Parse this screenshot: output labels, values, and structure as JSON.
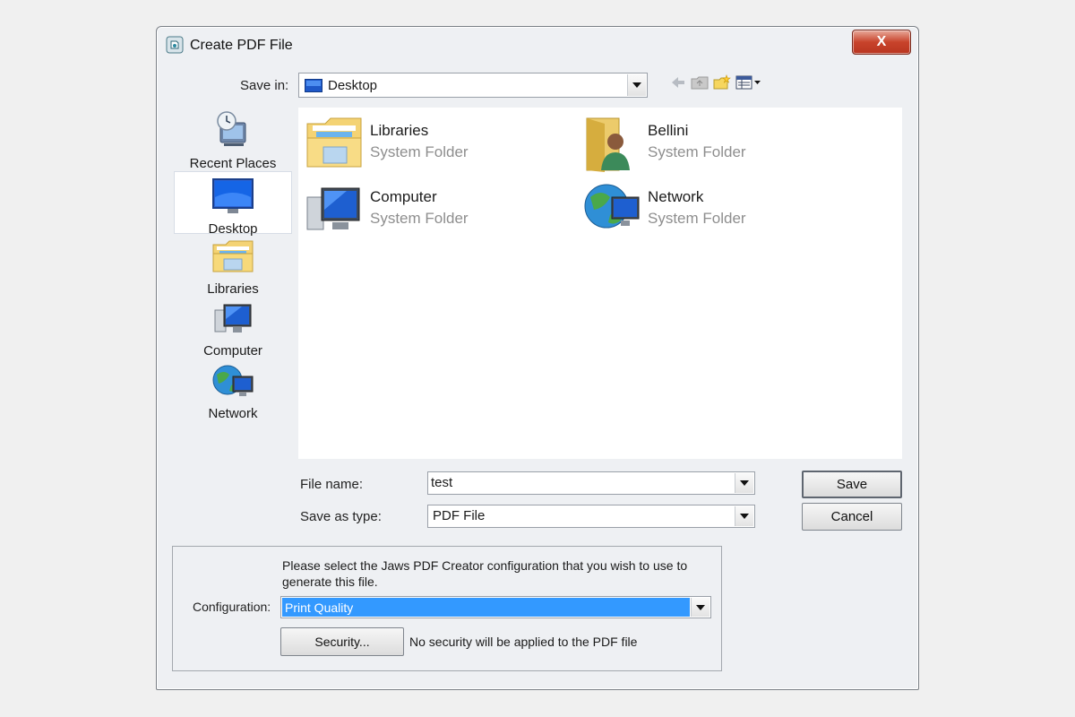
{
  "window": {
    "title": "Create PDF File",
    "close_label": "X"
  },
  "save_in": {
    "label": "Save in:",
    "value": "Desktop"
  },
  "places": [
    {
      "label": "Recent Places",
      "icon": "recent-places-icon"
    },
    {
      "label": "Desktop",
      "icon": "desktop-icon",
      "selected": true
    },
    {
      "label": "Libraries",
      "icon": "libraries-icon"
    },
    {
      "label": "Computer",
      "icon": "computer-icon"
    },
    {
      "label": "Network",
      "icon": "network-icon"
    }
  ],
  "files": [
    {
      "name": "Libraries",
      "type": "System Folder",
      "icon": "libraries-folder-icon"
    },
    {
      "name": "Bellini",
      "type": "System Folder",
      "icon": "user-folder-icon"
    },
    {
      "name": "Computer",
      "type": "System Folder",
      "icon": "computer-icon"
    },
    {
      "name": "Network",
      "type": "System Folder",
      "icon": "network-icon"
    }
  ],
  "file_name": {
    "label": "File name:",
    "value": "test"
  },
  "save_as_type": {
    "label": "Save as type:",
    "value": "PDF File"
  },
  "buttons": {
    "save": "Save",
    "cancel": "Cancel",
    "security": "Security..."
  },
  "config": {
    "description": "Please select the Jaws PDF Creator configuration that you wish to use to generate this file.",
    "label": "Configuration:",
    "value": "Print Quality",
    "security_note": "No security will be applied to the PDF file"
  },
  "colors": {
    "selection": "#3399ff",
    "window_bg": "#eef0f3",
    "close_button": "#c8432b"
  }
}
